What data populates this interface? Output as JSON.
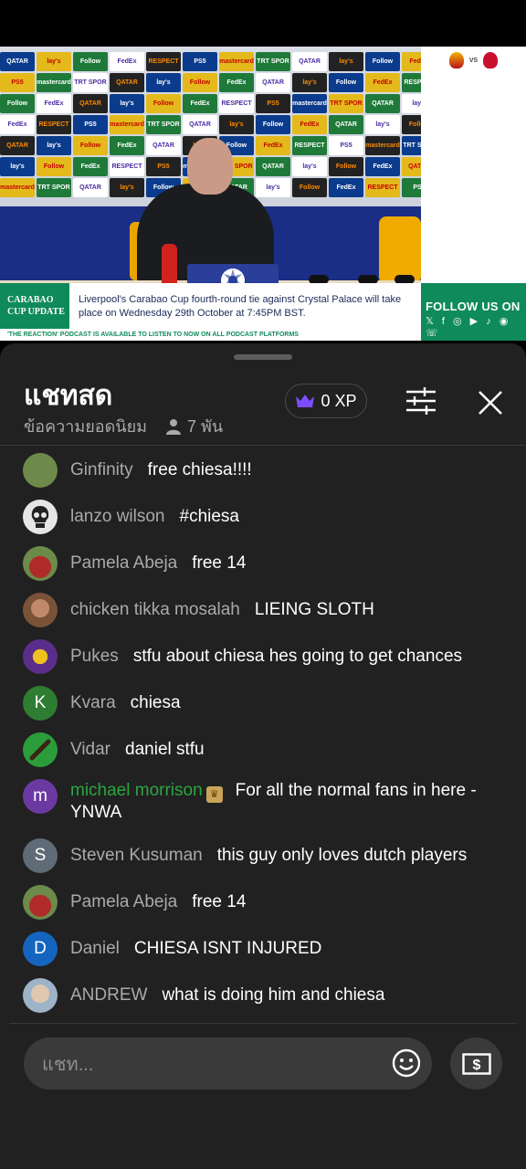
{
  "video": {
    "sponsors": [
      "QATAR",
      "lay's",
      "Follow",
      "FedEx",
      "RESPECT",
      "PS5",
      "mastercard",
      "TRT SPOR",
      "QATAR",
      "lay's",
      "Follow",
      "FedEx"
    ],
    "vs_label": "VS",
    "team_right": "LFC",
    "lower_third": {
      "tag": "CARABAO CUP UPDATE",
      "headline": "Liverpool's Carabao Cup fourth-round tie against Crystal Palace will take place on Wednesday 29th October at 7:45PM BST.",
      "ticker": "'THE REACTION' PODCAST IS AVAILABLE TO LISTEN TO NOW ON ALL PODCAST PLATFORMS"
    },
    "follow": {
      "title": "FOLLOW US ON",
      "icons": "𝕏 f ◎ ▶ ♪ ◉ ☏"
    }
  },
  "chat": {
    "title": "แชทสด",
    "mode": "ข้อความยอดนิยม",
    "viewers": "7 พัน",
    "xp": "0 XP",
    "input_placeholder": "แชท...",
    "messages": [
      {
        "author": "Ginfinity",
        "text": "free chiesa!!!!",
        "avatar": "photo",
        "avatar_color": "#6e8a4a"
      },
      {
        "author": "lanzo wilson",
        "text": "#chiesa",
        "avatar": "skull",
        "avatar_color": "#e6e6e6"
      },
      {
        "author": "Pamela Abeja",
        "text": "free 14",
        "avatar": "photo",
        "avatar_color": "#b02a2a"
      },
      {
        "author": "chicken tikka mosalah",
        "text": "LIEING SLOTH",
        "avatar": "photo",
        "avatar_color": "#7a5238"
      },
      {
        "author": "Pukes",
        "text": "stfu about chiesa hes going to get chances",
        "avatar": "photo",
        "avatar_color": "#5a2d8a"
      },
      {
        "author": "Kvara",
        "text": "chiesa",
        "avatar": "K",
        "avatar_color": "#2e7d32"
      },
      {
        "author": "Vidar",
        "text": "daniel stfu",
        "avatar": "photo",
        "avatar_color": "#2a9d3a"
      },
      {
        "author": "michael morrison",
        "text": "For all the normal fans in here - YNWA",
        "avatar": "m",
        "avatar_color": "#6a3aa2",
        "member": true
      },
      {
        "author": "Steven Kusuman",
        "text": "this guy only loves dutch players",
        "avatar": "S",
        "avatar_color": "#5f6b76"
      },
      {
        "author": "Pamela Abeja",
        "text": "free 14",
        "avatar": "photo",
        "avatar_color": "#b02a2a"
      },
      {
        "author": "Daniel",
        "text": "CHIESA ISNT INJURED",
        "avatar": "D",
        "avatar_color": "#1565c0"
      },
      {
        "author": "ANDREW",
        "text": "what is doing him and chiesa",
        "avatar": "photo",
        "avatar_color": "#c9b5a0"
      }
    ]
  },
  "colors": {
    "accent_green": "#0f8a5a",
    "member_green": "#2ba640",
    "chat_bg": "#212121",
    "crown_purple": "#7c4dff"
  }
}
